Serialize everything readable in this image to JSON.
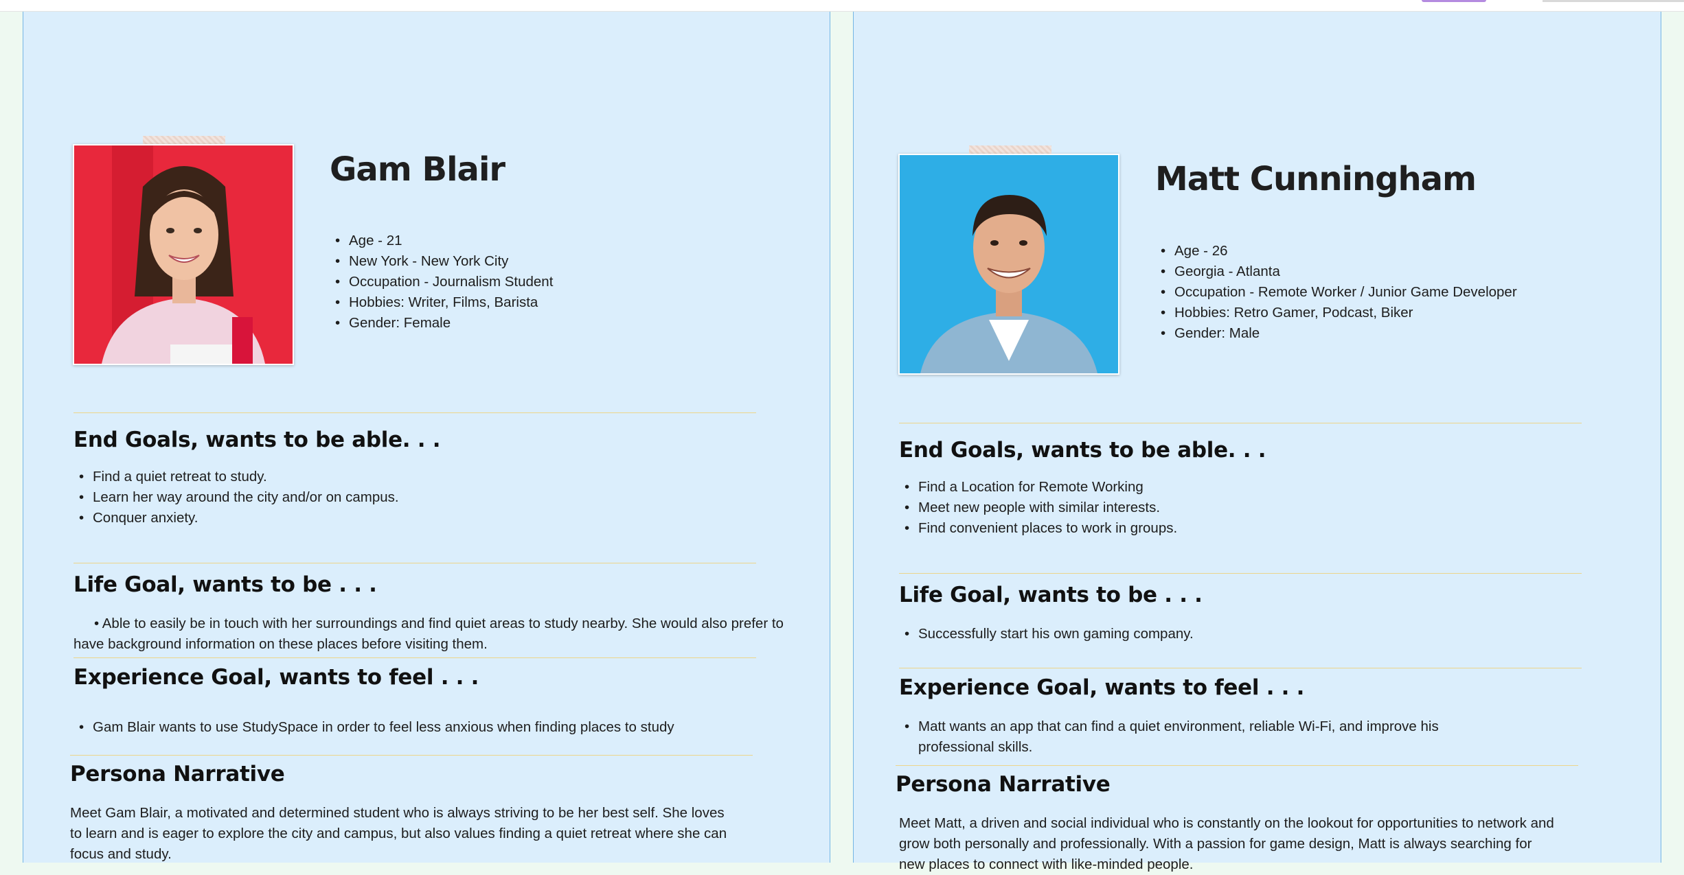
{
  "personas": [
    {
      "name": "Gam Blair",
      "facts": [
        "Age - 21",
        "New York - New York City",
        "Occupation - Journalism Student",
        "Hobbies: Writer, Films, Barista",
        "Gender: Female"
      ],
      "end_goals_title": "End Goals, wants to be able. . .",
      "end_goals": [
        "Find a quiet retreat to study.",
        "Learn her way around the city and/or on campus.",
        "Conquer anxiety."
      ],
      "life_goal_title": "Life Goal, wants to be . . .",
      "life_goal": "Able to easily be in touch with her surroundings and find quiet areas to study nearby. She would also prefer to have background information on these places before visiting them.",
      "experience_goal_title": "Experience Goal, wants to feel . . .",
      "experience_goal": "Gam Blair wants to use StudySpace in order to feel less anxious when finding places to study",
      "narrative_title": "Persona Narrative",
      "narrative": "Meet Gam Blair, a motivated and determined student who is always striving to be her best self. She loves to learn and is eager to explore the city and campus, but also values finding a quiet retreat where she can focus and study.",
      "photo": {
        "background": "#e8283c",
        "icon": "woman-portrait"
      }
    },
    {
      "name": "Matt Cunningham",
      "facts": [
        "Age - 26",
        "Georgia - Atlanta",
        "Occupation - Remote Worker / Junior Game Developer",
        "Hobbies: Retro Gamer, Podcast, Biker",
        "Gender: Male"
      ],
      "end_goals_title": "End Goals, wants to be able. . .",
      "end_goals": [
        "Find a Location for Remote Working",
        "Meet new people with similar interests.",
        "Find convenient places to work in groups."
      ],
      "life_goal_title": "Life Goal, wants to be . . .",
      "life_goal": "Successfully start his own gaming company.",
      "experience_goal_title": "Experience Goal, wants to feel . . .",
      "experience_goal": "Matt wants an app that can find a quiet environment, reliable Wi-Fi, and improve his professional skills.",
      "narrative_title": "Persona Narrative",
      "narrative": "Meet Matt, a driven and social individual who is constantly on the lookout for opportunities to network and grow both personally and professionally. With a passion for game design, Matt is always searching for new places to connect with like-minded people.",
      "photo": {
        "background": "#2eaee6",
        "icon": "man-portrait"
      }
    }
  ],
  "colors": {
    "card": "#dbeefc",
    "card_border": "#74b6e4",
    "rule": "#ecd58a",
    "page": "#eef9f1"
  }
}
